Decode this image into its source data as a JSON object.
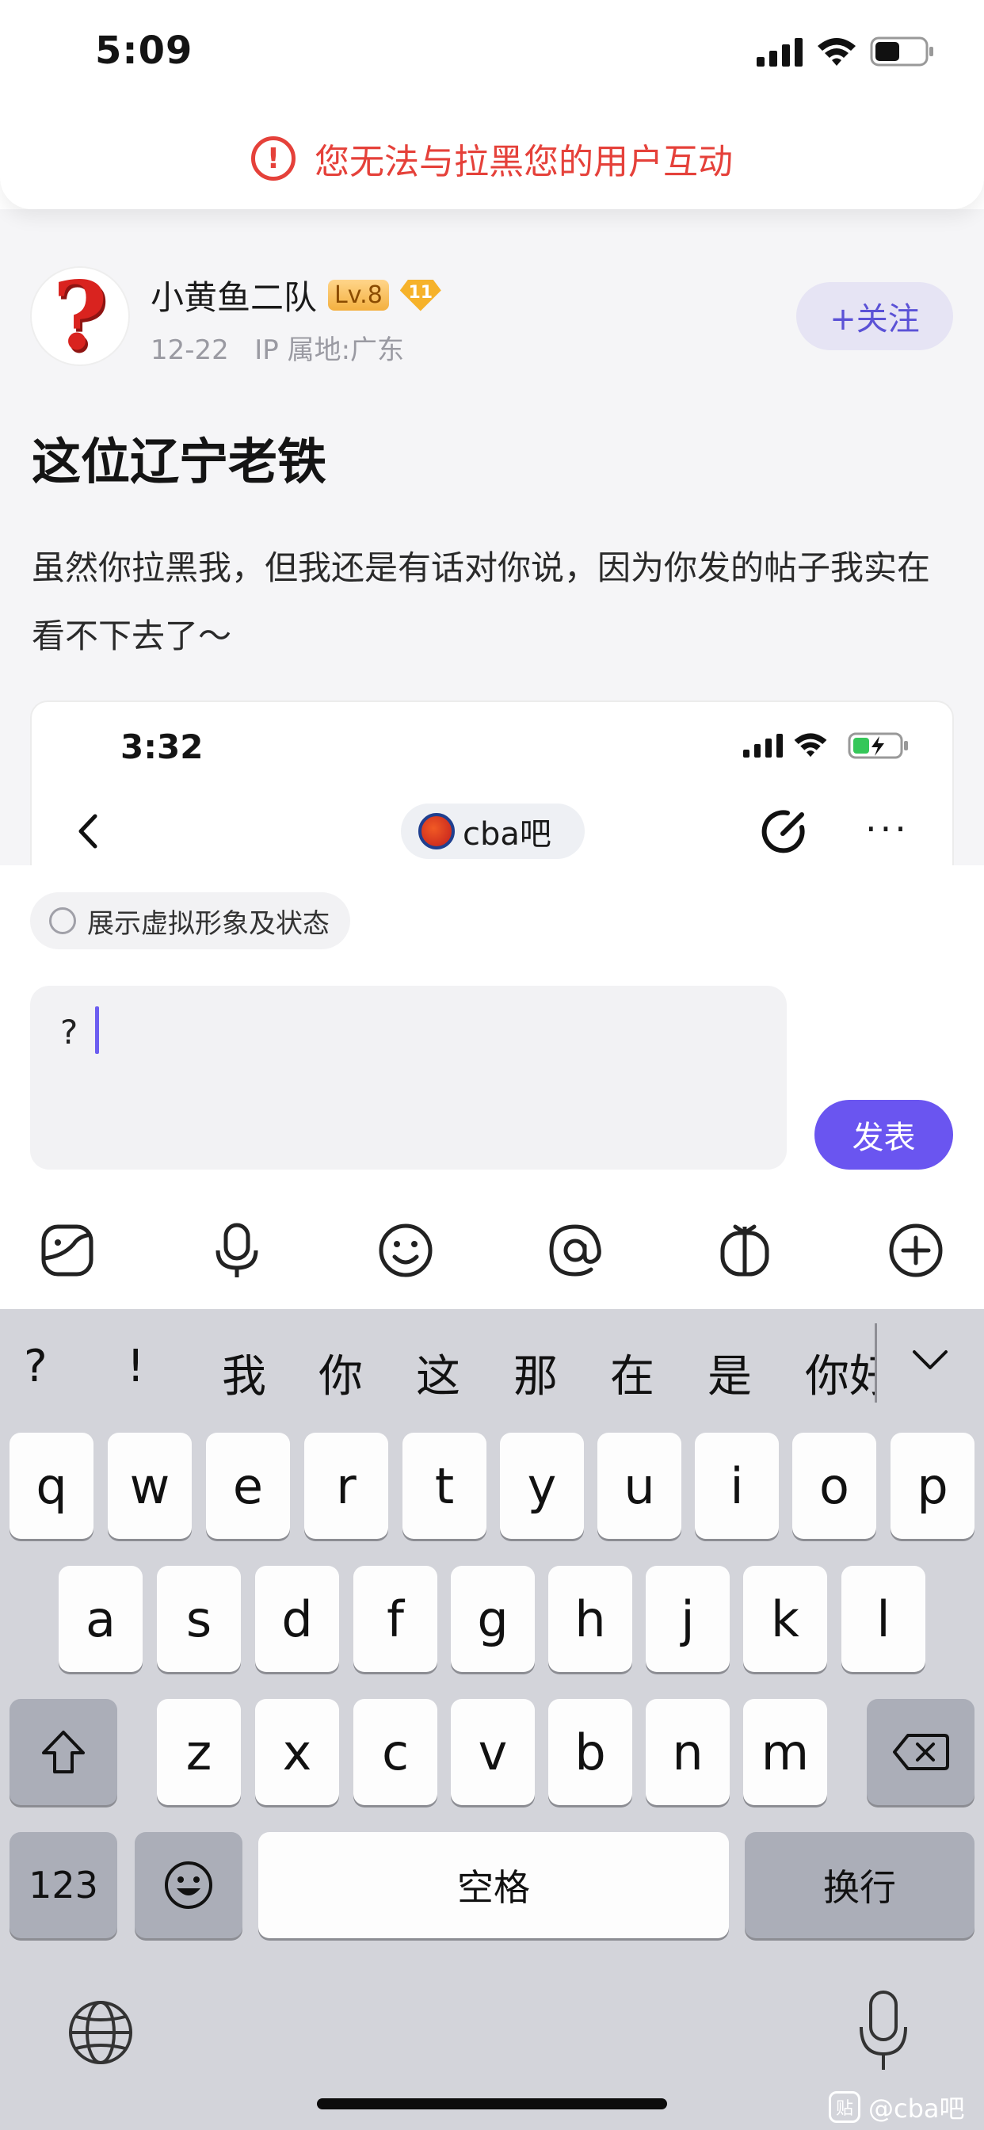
{
  "status_bar": {
    "time": "5:09"
  },
  "banner": {
    "icon": "exclamation-circle-icon",
    "text": "您无法与拉黑您的用户互动",
    "color": "#e5413a"
  },
  "post": {
    "author": {
      "name": "小黄鱼二队",
      "level": "Lv.8",
      "badge": "11",
      "date": "12-22",
      "ip": "IP 属地:广东"
    },
    "follow_label": "+关注",
    "title": "这位辽宁老铁",
    "body": "虽然你拉黑我，但我还是有话对你说，因为你发的帖子我实在看不下去了～",
    "embedded_screenshot": {
      "time": "3:32",
      "forum_name": "cba吧"
    }
  },
  "composer": {
    "avatar_toggle_label": "展示虚拟形象及状态",
    "input_value": "?",
    "send_label": "发表",
    "accent": "#6a55f0",
    "tools": [
      "sticker-icon",
      "voice-icon",
      "emoji-icon",
      "mention-icon",
      "gift-icon",
      "add-icon"
    ]
  },
  "keyboard": {
    "candidates": [
      "?",
      "!",
      "我",
      "你",
      "这",
      "那",
      "在",
      "是",
      "你好"
    ],
    "row1": [
      "q",
      "w",
      "e",
      "r",
      "t",
      "y",
      "u",
      "i",
      "o",
      "p"
    ],
    "row2": [
      "a",
      "s",
      "d",
      "f",
      "g",
      "h",
      "j",
      "k",
      "l"
    ],
    "row3": [
      "z",
      "x",
      "c",
      "v",
      "b",
      "n",
      "m"
    ],
    "numbers_label": "123",
    "space_label": "空格",
    "return_label": "换行"
  },
  "watermark": {
    "logo": "贴",
    "text": "@cba吧"
  }
}
